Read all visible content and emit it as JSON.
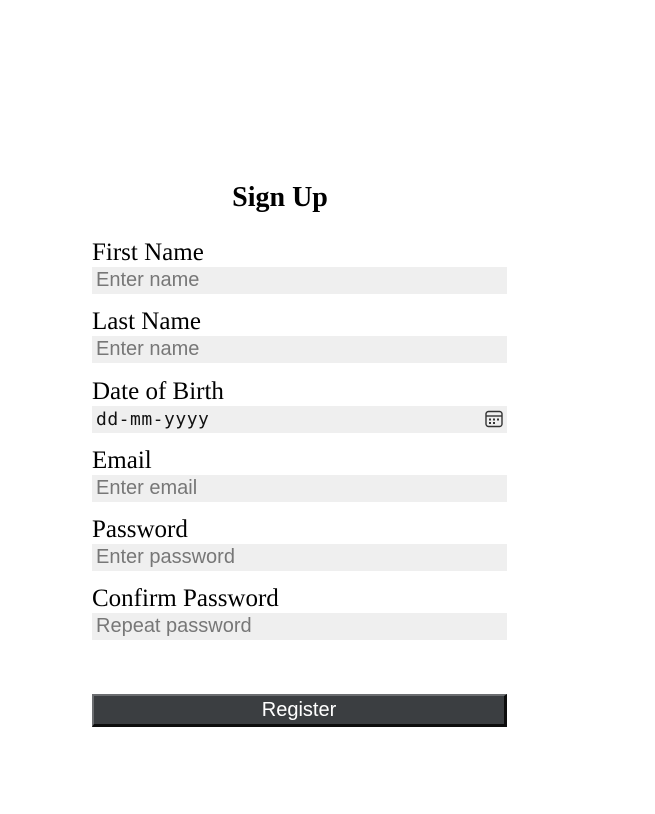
{
  "form": {
    "title": "Sign Up",
    "fields": [
      {
        "label": "First Name",
        "placeholder": "Enter name"
      },
      {
        "label": "Last Name",
        "placeholder": "Enter name"
      },
      {
        "label": "Date of Birth",
        "placeholder": "dd-mm-yyyy",
        "icon": "calendar-icon"
      },
      {
        "label": "Email",
        "placeholder": "Enter email"
      },
      {
        "label": "Password",
        "placeholder": "Enter password"
      },
      {
        "label": "Confirm Password",
        "placeholder": "Repeat password"
      }
    ],
    "submit_label": "Register"
  },
  "colors": {
    "input_background": "#efefef",
    "placeholder_text": "#777777",
    "button_background": "#3b3e41",
    "button_text": "#ffffff"
  }
}
